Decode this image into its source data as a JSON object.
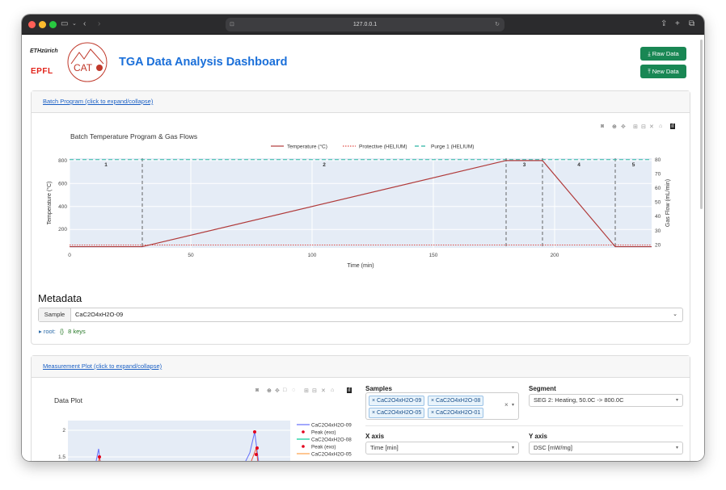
{
  "browser": {
    "url": "127.0.0.1"
  },
  "header": {
    "title": "TGA Data Analysis Dashboard",
    "eth_logo": "ETHzürich",
    "epfl_logo": "EPFL",
    "cat_logo": "CAT",
    "raw_data_label": "Raw Data",
    "new_data_label": "New Data"
  },
  "batch": {
    "link": "Batch Program (click to expand/collapse)",
    "chart_data": {
      "type": "line",
      "title": "Batch Temperature Program & Gas Flows",
      "xlabel": "Time (min)",
      "ylabel": "Temperature (°C)",
      "y2label": "Gas Flow (mL/min)",
      "xlim": [
        0,
        240
      ],
      "ylim": [
        40,
        820
      ],
      "y2lim": [
        18,
        81
      ],
      "x_ticks": [
        "0",
        "50",
        "100",
        "150",
        "200"
      ],
      "y_ticks": [
        "200",
        "400",
        "600",
        "800"
      ],
      "y2_ticks": [
        "20",
        "30",
        "40",
        "50",
        "60",
        "70",
        "80"
      ],
      "segments": [
        "1",
        "2",
        "3",
        "4",
        "5"
      ],
      "segment_bounds": [
        30,
        180,
        195,
        225
      ],
      "series": [
        {
          "name": "Temperature (°C)",
          "x": [
            0,
            30,
            180,
            195,
            225,
            240
          ],
          "y": [
            50,
            50,
            800,
            800,
            50,
            50
          ]
        },
        {
          "name": "Protective (HELIUM)",
          "axis": "y2",
          "x": [
            0,
            240
          ],
          "y": [
            20,
            20
          ]
        },
        {
          "name": "Purge 1 (HELIUM)",
          "axis": "y2",
          "x": [
            0,
            240
          ],
          "y": [
            80,
            80
          ]
        }
      ]
    }
  },
  "metadata": {
    "heading": "Metadata",
    "sample_label": "Sample",
    "sample_value": "CaC2O4xH2O-09",
    "root_label": "▸ root:",
    "root_braces": "{}",
    "root_count": "8 keys"
  },
  "measurement": {
    "link": "Measurement Plot (click to expand/collapse)",
    "plot_title": "Data Plot",
    "samples_label": "Samples",
    "samples": [
      "CaC2O4xH2O-09",
      "CaC2O4xH2O-08",
      "CaC2O4xH2O-05",
      "CaC2O4xH2O-01"
    ],
    "segment_label": "Segment",
    "segment_value": "SEG 2: Heating, 50.0C -> 800.0C",
    "x_axis_label": "X axis",
    "x_axis_value": "Time [min]",
    "y_axis_label": "Y axis",
    "y_axis_value": "DSC [mW/mg]",
    "legend": [
      "CaC2O4xH2O-09",
      "Peak (exo)",
      "CaC2O4xH2O-08",
      "Peak (exo)",
      "CaC2O4xH2O-05"
    ],
    "chart_data": {
      "type": "line",
      "y_ticks": [
        "2",
        "1.5"
      ],
      "series": [
        {
          "name": "CaC2O4xH2O-09"
        },
        {
          "name": "CaC2O4xH2O-08"
        },
        {
          "name": "CaC2O4xH2O-05"
        }
      ]
    }
  },
  "colors": {
    "accent": "#1a6fd9",
    "button": "#198754",
    "temp": "#b03a3a",
    "purge": "#2bb5a4",
    "protect": "#e0504a"
  }
}
